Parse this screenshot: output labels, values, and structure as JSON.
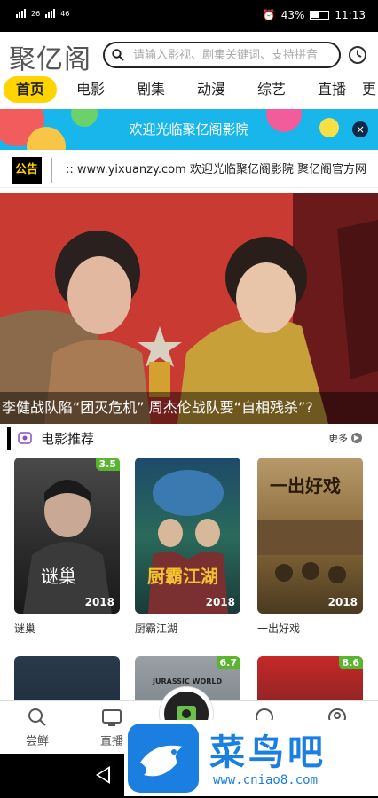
{
  "status": {
    "left_a": "26",
    "left_b": "46",
    "battery": "43%",
    "time": "11:13"
  },
  "header": {
    "logo": "聚亿阁",
    "search_placeholder": "请输入影视、剧集关键词、支持拼音"
  },
  "tabs": [
    "首页",
    "电影",
    "剧集",
    "动漫",
    "综艺",
    "直播",
    "更"
  ],
  "banner": {
    "text": "欢迎光临聚亿阁影院",
    "close": "×"
  },
  "notice": {
    "badge": "公告",
    "text": ":: www.yixuanzy.com 欢迎光临聚亿阁影院 聚亿阁官方网"
  },
  "hero": {
    "caption": "李健战队陷“团灭危机” 周杰伦战队要“自相残杀”?"
  },
  "section": {
    "title": "电影推荐",
    "more": "更多"
  },
  "movies": [
    {
      "name": "谜巢",
      "rating": "3.5",
      "year": "2018",
      "poster_text": "谜巢"
    },
    {
      "name": "厨霸江湖",
      "rating": "",
      "year": "2018",
      "poster_text": "厨霸江湖"
    },
    {
      "name": "一出好戏",
      "rating": "",
      "year": "2018",
      "poster_text": "一出好戏"
    },
    {
      "name": "",
      "rating": "",
      "year": "",
      "poster_text": ""
    },
    {
      "name": "",
      "rating": "6.7",
      "year": "",
      "poster_text": "JURASSIC WORLD"
    },
    {
      "name": "",
      "rating": "8.6",
      "year": "",
      "poster_text": ""
    }
  ],
  "bottom_nav": {
    "items": [
      "尝鲜",
      "直播"
    ]
  },
  "watermark": {
    "cn": "菜鸟吧",
    "url": "www.cniao8.com"
  },
  "colors": {
    "accent_yellow": "#ffd400",
    "banner_blue": "#18b6ea",
    "rating_green": "#59b52d",
    "watermark_blue": "#1a7fe0"
  }
}
